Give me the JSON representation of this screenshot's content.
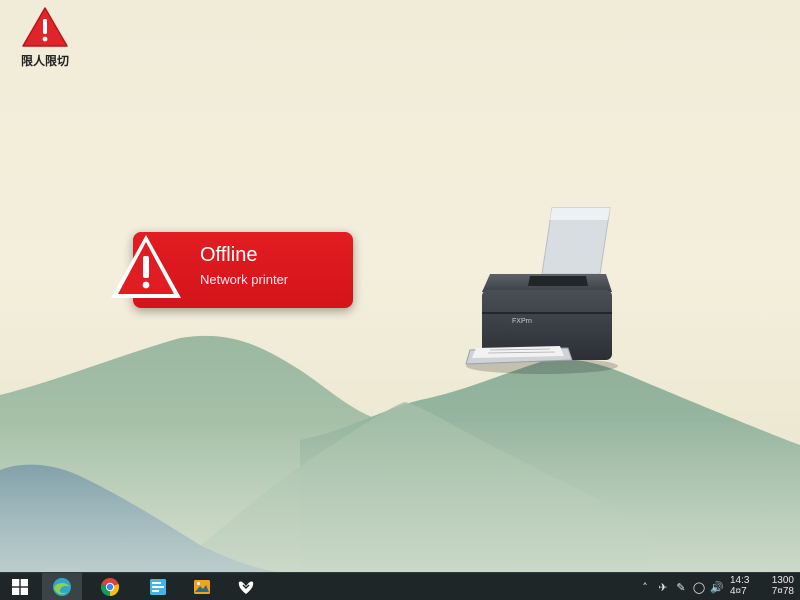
{
  "desktop": {
    "shortcut_label": "限人限切"
  },
  "notification": {
    "title": "Offline",
    "subtitle": "Network printer",
    "color": "#d91a1f"
  },
  "printer": {
    "brand_label": "FXPrn",
    "status": "offline"
  },
  "taskbar": {
    "apps": [
      {
        "name": "start",
        "icon": "windows-logo-icon"
      },
      {
        "name": "browser-edge",
        "icon": "edge-icon"
      },
      {
        "name": "chrome",
        "icon": "chrome-icon"
      },
      {
        "name": "file-explorer",
        "icon": "file-explorer-icon"
      },
      {
        "name": "photos",
        "icon": "photos-icon"
      },
      {
        "name": "xbox",
        "icon": "xbox-icon"
      }
    ],
    "clock_line1_left": "14:3",
    "clock_line1_right": "1300",
    "clock_line2_left": "4¤7",
    "clock_line2_right": "7¤78"
  }
}
